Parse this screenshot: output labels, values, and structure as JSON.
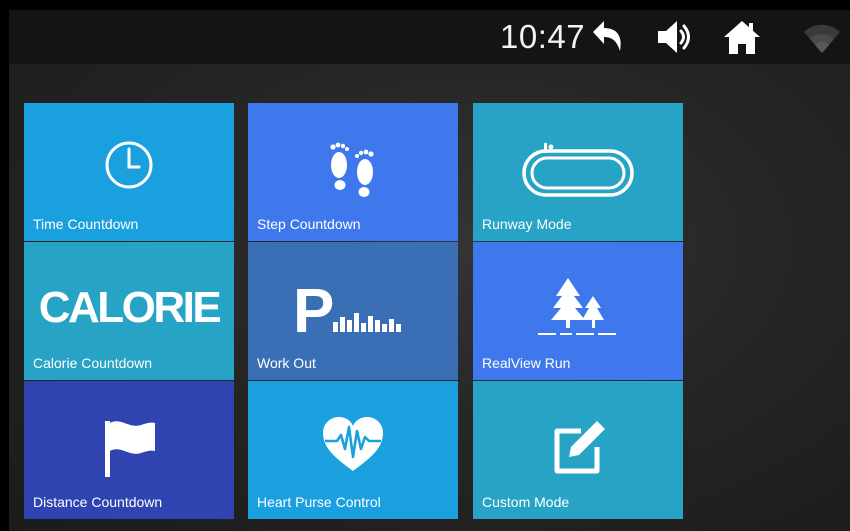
{
  "status_bar": {
    "time": "10:47",
    "icons": [
      "back-arrow-icon",
      "volume-icon",
      "home-icon",
      "wifi-icon"
    ]
  },
  "colors": {
    "cyan": "#1aa0de",
    "blue": "#3e78ec",
    "teal": "#27a3c5",
    "steel": "#3b6fb5",
    "indigo": "#2f44b0"
  },
  "tiles": [
    {
      "label": "Time Countdown",
      "icon": "clock-icon",
      "color": "#1aa0de"
    },
    {
      "label": "Step Countdown",
      "icon": "footprints-icon",
      "color": "#3e78ec"
    },
    {
      "label": "Runway Mode",
      "icon": "running-track-icon",
      "color": "#27a3c5"
    },
    {
      "label": "Calorie Countdown",
      "icon": "calorie-text-icon",
      "icon_text": "CALORIE",
      "color": "#27a3c5"
    },
    {
      "label": "Work Out",
      "icon": "program-bars-icon",
      "icon_text": "P",
      "color": "#3b6fb5"
    },
    {
      "label": "RealView Run",
      "icon": "trees-icon",
      "color": "#3e78ec"
    },
    {
      "label": "Distance Countdown",
      "icon": "flag-icon",
      "color": "#2f44b0"
    },
    {
      "label": "Heart Purse Control",
      "icon": "heart-pulse-icon",
      "color": "#1aa0de"
    },
    {
      "label": "Custom Mode",
      "icon": "edit-icon",
      "color": "#27a3c5"
    }
  ]
}
